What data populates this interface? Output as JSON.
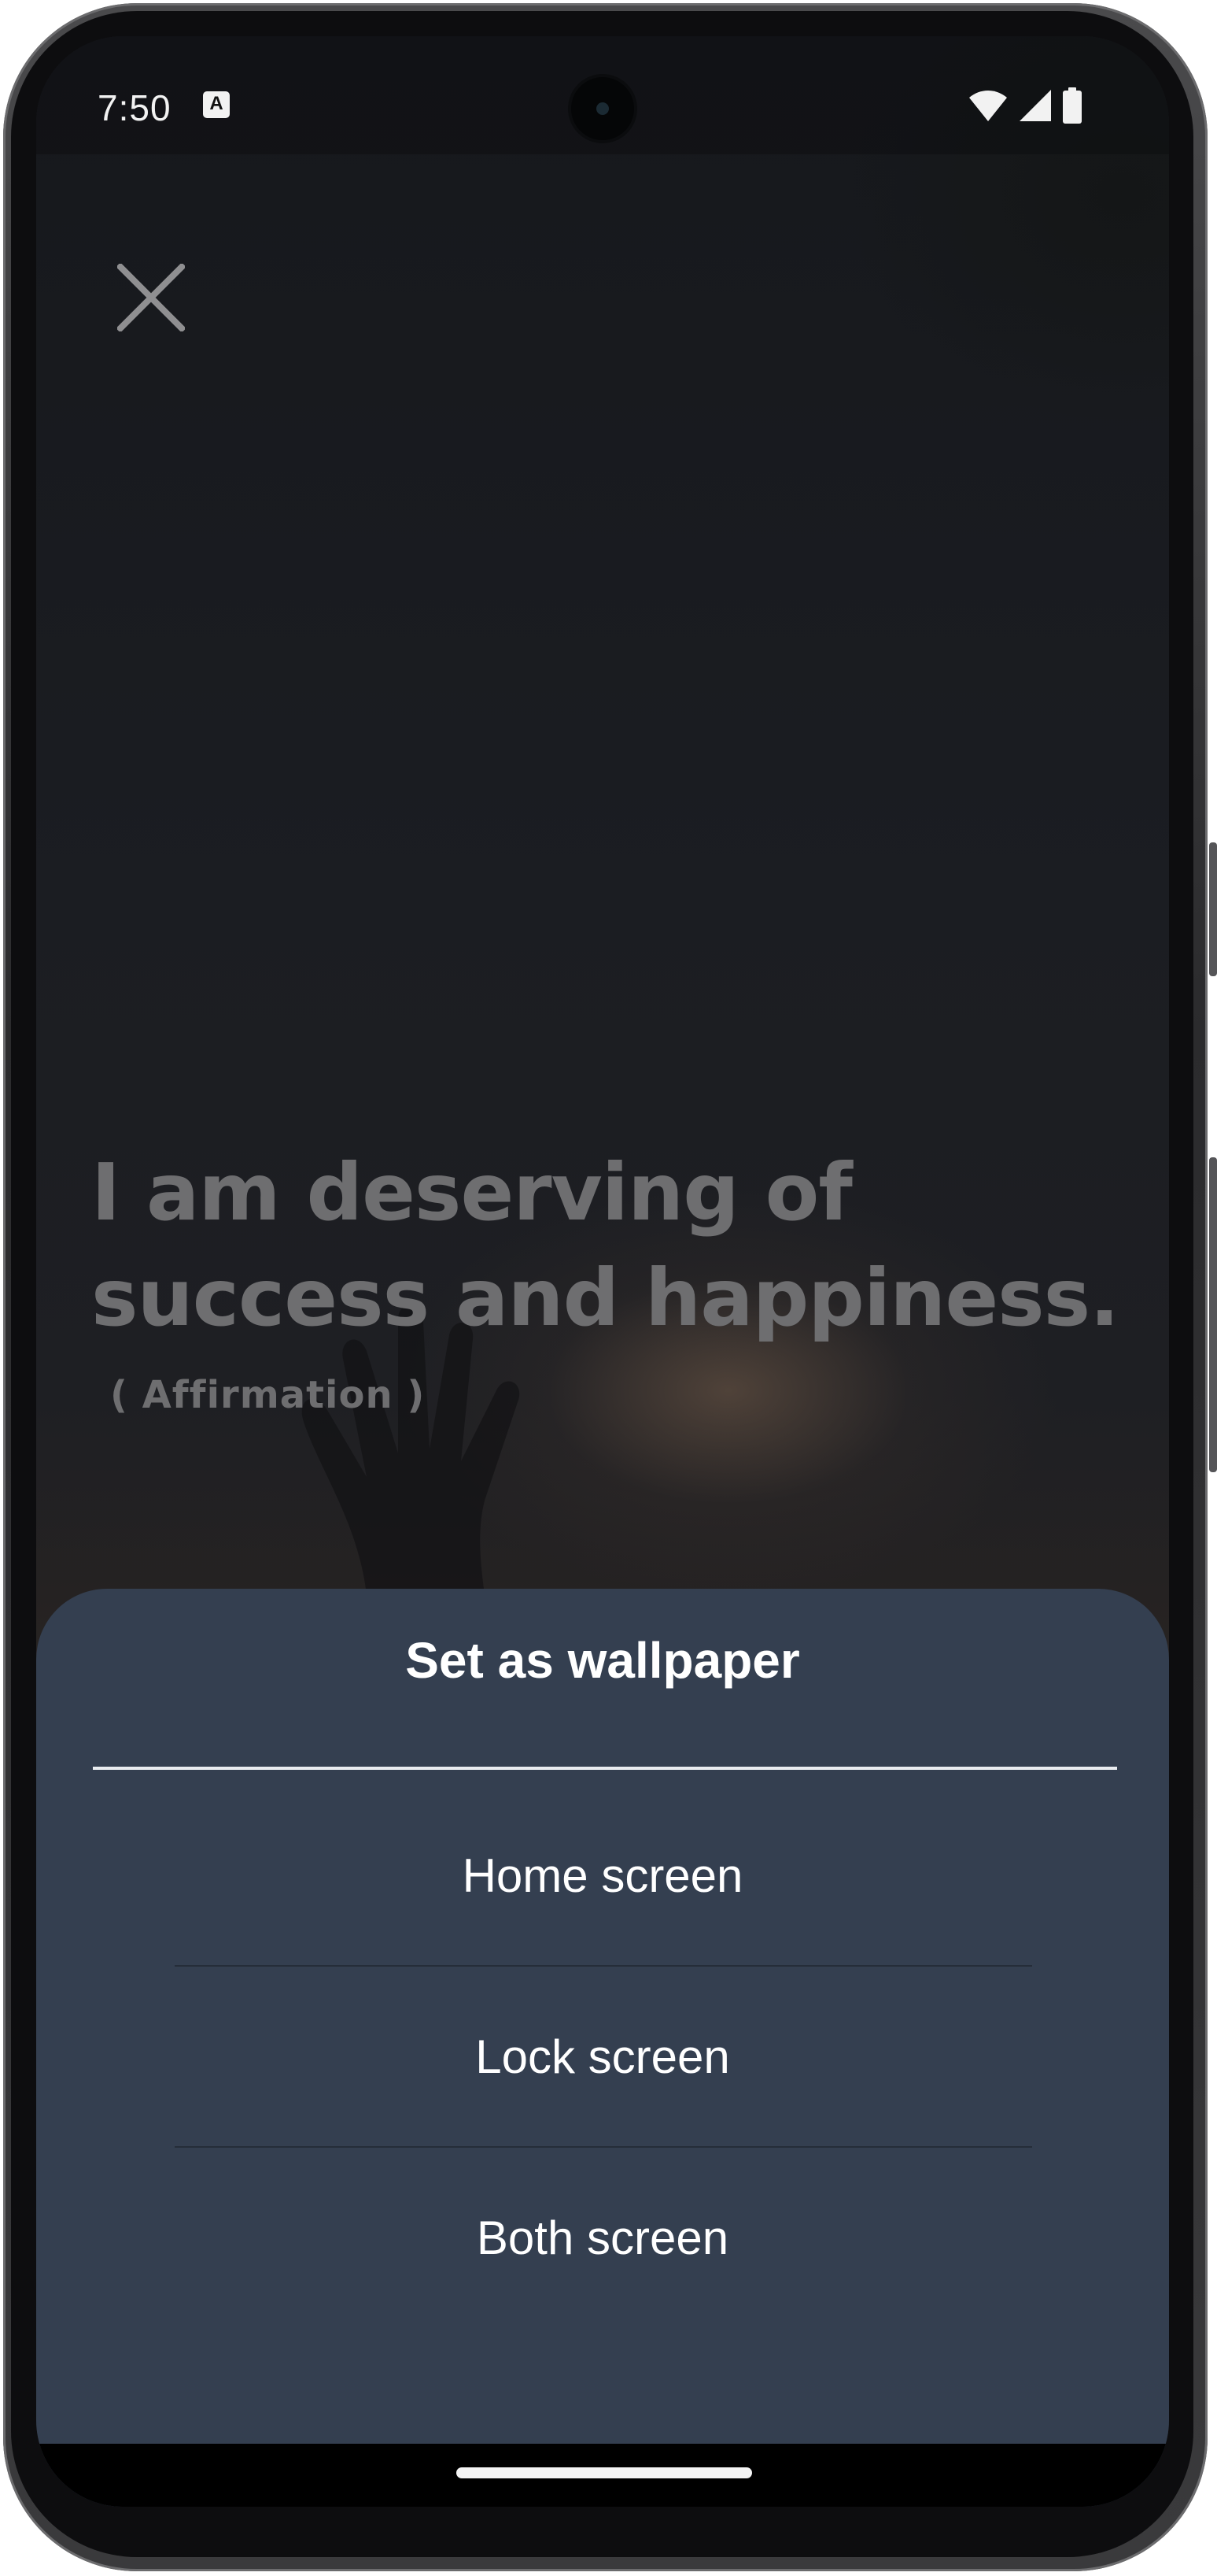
{
  "status_bar": {
    "time": "7:50",
    "notification_icon": "A"
  },
  "icons": {
    "close": "close-icon",
    "wifi": "wifi-icon",
    "signal": "cellular-signal-icon",
    "battery": "battery-icon"
  },
  "quote": {
    "line1": "I am deserving of",
    "line2": "success and happiness.",
    "source": "( Affirmation )"
  },
  "sheet": {
    "title": "Set as wallpaper",
    "options": [
      {
        "label": "Home screen"
      },
      {
        "label": "Lock screen"
      },
      {
        "label": "Both screen"
      }
    ]
  },
  "colors": {
    "sheet_background": "#343f50",
    "quote_text": "#6e6e70",
    "option_text": "#ffffff"
  }
}
